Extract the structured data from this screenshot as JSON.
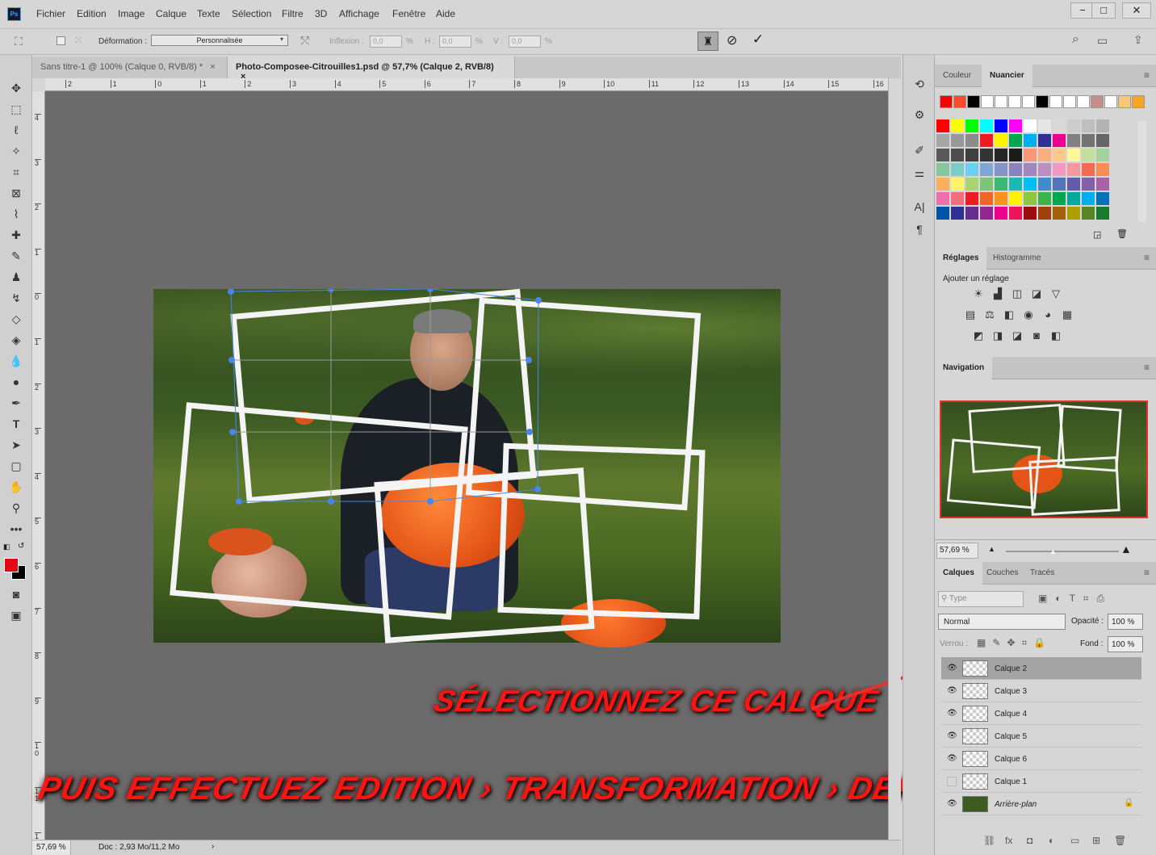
{
  "app": {
    "logo": "Ps",
    "menu": [
      "Fichier",
      "Edition",
      "Image",
      "Calque",
      "Texte",
      "Sélection",
      "Filtre",
      "3D",
      "Affichage",
      "Fenêtre",
      "Aide"
    ],
    "window_buttons": [
      "−",
      "□",
      "✕"
    ]
  },
  "options": {
    "deform_label": "Déformation :",
    "deform_value": "Personnalisée",
    "inflexion_label": "Inflexion :",
    "inflexion_value": "0,0",
    "pct": "%",
    "h_label": "H :",
    "h_value": "0,0",
    "v_label": "V :",
    "v_value": "0,0"
  },
  "tabs": [
    {
      "label": "Sans titre-1 @ 100% (Calque 0, RVB/8) *",
      "close": "×"
    },
    {
      "label": "Photo-Composee-Citrouilles1.psd @ 57,7% (Calque 2, RVB/8)",
      "close": "×"
    }
  ],
  "ruler_top": [
    "2",
    "1",
    "0",
    "1",
    "2",
    "3",
    "4",
    "5",
    "6",
    "7",
    "8",
    "9",
    "10",
    "11",
    "12",
    "13",
    "14",
    "15",
    "16"
  ],
  "ruler_left": [
    "4",
    "3",
    "2",
    "1",
    "0",
    "1",
    "2",
    "3",
    "4",
    "5",
    "6",
    "7",
    "8",
    "9",
    "1 0",
    "1 1",
    "1"
  ],
  "status": {
    "zoom": "57,69 %",
    "doc": "Doc : 2,93 Mo/11,2 Mo",
    "arrow": "›"
  },
  "panels": {
    "swatches": {
      "tabs": [
        "Couleur",
        "Nuancier"
      ],
      "recent": [
        "#ff0000",
        "#ff4a2e",
        "#000000",
        "#ffffff",
        "#ffffff",
        "#ffffff",
        "#ffffff",
        "#000000",
        "#ffffff",
        "#ffffff",
        "#ffffff",
        "#c88c8c",
        "#ffffff",
        "#f5c87a",
        "#f5a623"
      ],
      "grid": [
        [
          "#ff0000",
          "#ffff00",
          "#00ff00",
          "#00ffff",
          "#0000ff",
          "#ff00ff",
          "#ffffff",
          "#e6e6e6",
          "#d9d9d9",
          "#cccccc",
          "#bfbfbf",
          "#b3b3b3"
        ],
        [
          "#a6a6a6",
          "#999999",
          "#8c8c8c",
          "#ed1c24",
          "#fff200",
          "#00a651",
          "#00aeef",
          "#2e3192",
          "#ec008c",
          "#808080",
          "#737373",
          "#666666"
        ],
        [
          "#595959",
          "#4d4d4d",
          "#404040",
          "#333333",
          "#262626",
          "#1a1a1a",
          "#f7977a",
          "#f9ad81",
          "#fdc68a",
          "#fff79a",
          "#c4df9b",
          "#a3d39c"
        ],
        [
          "#82ca9d",
          "#7bcdc8",
          "#6ecff6",
          "#7ea7d8",
          "#8493ca",
          "#8882be",
          "#a187be",
          "#bc8dbf",
          "#f49ac2",
          "#f6989d",
          "#f26c4f",
          "#f68e55"
        ],
        [
          "#fbaf5d",
          "#fff568",
          "#acd372",
          "#7cc576",
          "#3bb878",
          "#1abbb4",
          "#00bff3",
          "#438ccb",
          "#5574b9",
          "#605ca8",
          "#855fa8",
          "#a763a8"
        ],
        [
          "#f06eaa",
          "#f26d7d",
          "#ed1c24",
          "#f26522",
          "#f7941d",
          "#fff200",
          "#8dc63f",
          "#39b54a",
          "#00a651",
          "#00a99d",
          "#00aeef",
          "#0072bc"
        ],
        [
          "#0054a6",
          "#2e3192",
          "#662d91",
          "#92278f",
          "#ec008c",
          "#ed145b",
          "#9e0b0f",
          "#a0410d",
          "#a36209",
          "#aba000",
          "#598527",
          "#1a7b30"
        ]
      ]
    },
    "adjust": {
      "tabs": [
        "Réglages",
        "Histogramme"
      ],
      "hint": "Ajouter un réglage",
      "row1": [
        "☀",
        "▟",
        "◫",
        "◪",
        "▽"
      ],
      "row2": [
        "▤",
        "⚖",
        "◧",
        "◉",
        "◕",
        "▦"
      ],
      "row3": [
        "◩",
        "◨",
        "◪",
        "◙",
        "◧"
      ]
    },
    "navigation": {
      "title": "Navigation",
      "zoom": "57,69 %"
    },
    "layers": {
      "tabs": [
        "Calques",
        "Couches",
        "Tracés"
      ],
      "filter_placeholder": "Type",
      "blend": "Normal",
      "opacity_label": "Opacité :",
      "opacity": "100 %",
      "lock_label": "Verrou :",
      "fill_label": "Fond :",
      "fill": "100 %",
      "items": [
        {
          "name": "Calque 2",
          "selected": true
        },
        {
          "name": "Calque 3"
        },
        {
          "name": "Calque 4"
        },
        {
          "name": "Calque 5"
        },
        {
          "name": "Calque 6"
        },
        {
          "name": "Calque 1",
          "hidden": true
        },
        {
          "name": "Arrière-plan",
          "locked": true
        }
      ],
      "footer": [
        "⛓",
        "fx",
        "◘",
        "◐",
        "▭",
        "⊞",
        "🗑"
      ]
    }
  },
  "annotations": {
    "select": "SÉLECTIONNEZ CE CALQUE",
    "then": "PUIS EFFECTUEZ EDITION › TRANSFORMATION › DÉFORMATION"
  },
  "colors": {
    "annotation": "#ff1414",
    "selection": "#a3a3a3",
    "accent": "#4a86e8"
  }
}
